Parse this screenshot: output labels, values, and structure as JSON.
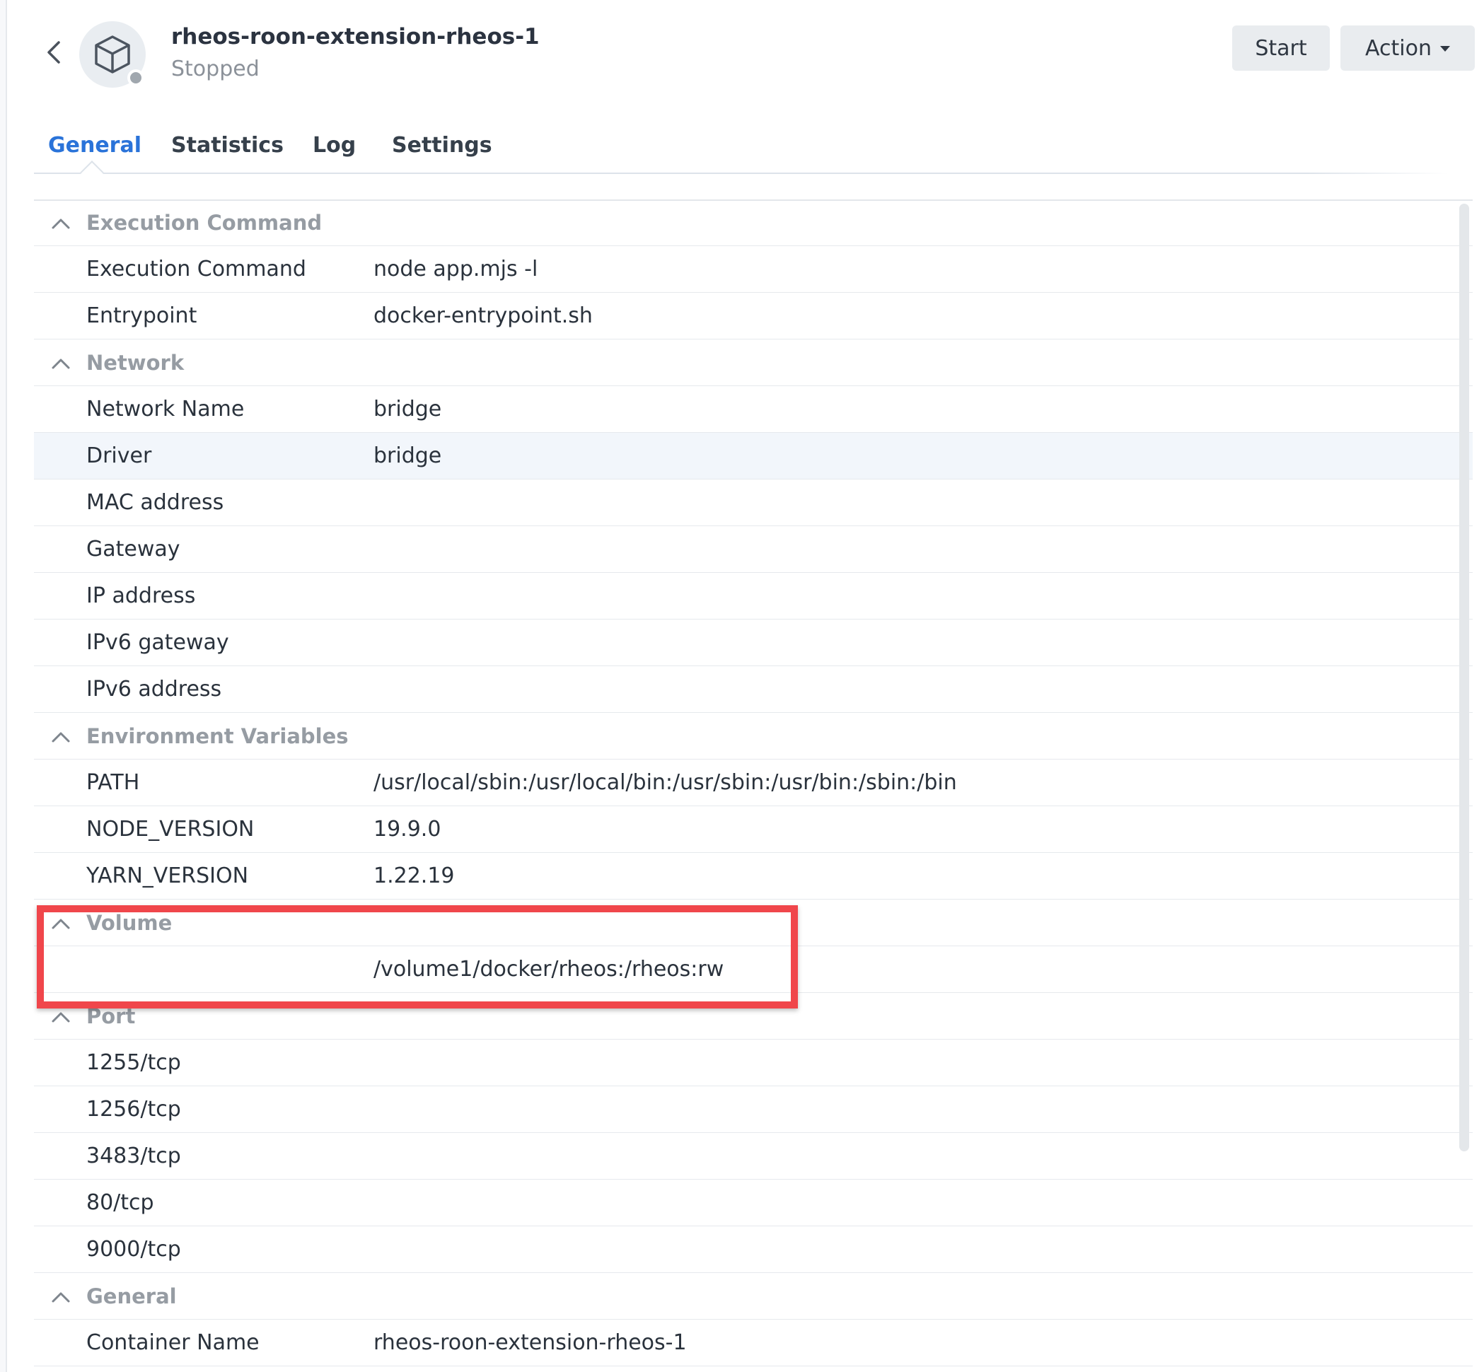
{
  "header": {
    "title": "rheos-roon-extension-rheos-1",
    "status": "Stopped",
    "status_color": "#a0a7ae",
    "icons": {
      "back": "chevron-left-icon",
      "container": "cube-icon"
    },
    "buttons": {
      "start_label": "Start",
      "action_label": "Action"
    }
  },
  "tabs": [
    {
      "label": "General",
      "active": true
    },
    {
      "label": "Statistics",
      "active": false
    },
    {
      "label": "Log",
      "active": false
    },
    {
      "label": "Settings",
      "active": false
    }
  ],
  "colors": {
    "accent": "#2a73d9",
    "annotation": "#f0464b"
  },
  "sections": {
    "execution": {
      "title": "Execution Command",
      "rows": [
        {
          "key": "Execution Command",
          "value": "node app.mjs -l"
        },
        {
          "key": "Entrypoint",
          "value": "docker-entrypoint.sh"
        }
      ]
    },
    "network": {
      "title": "Network",
      "rows": [
        {
          "key": "Network Name",
          "value": "bridge"
        },
        {
          "key": "Driver",
          "value": "bridge"
        },
        {
          "key": "MAC address",
          "value": ""
        },
        {
          "key": "Gateway",
          "value": ""
        },
        {
          "key": "IP address",
          "value": ""
        },
        {
          "key": "IPv6 gateway",
          "value": ""
        },
        {
          "key": "IPv6 address",
          "value": ""
        }
      ]
    },
    "env": {
      "title": "Environment Variables",
      "rows": [
        {
          "key": "PATH",
          "value": "/usr/local/sbin:/usr/local/bin:/usr/sbin:/usr/bin:/sbin:/bin"
        },
        {
          "key": "NODE_VERSION",
          "value": "19.9.0"
        },
        {
          "key": "YARN_VERSION",
          "value": "1.22.19"
        }
      ]
    },
    "volume": {
      "title": "Volume",
      "rows": [
        {
          "key": "",
          "value": "/volume1/docker/rheos:/rheos:rw"
        }
      ]
    },
    "port": {
      "title": "Port",
      "rows": [
        {
          "key": "1255/tcp",
          "value": ""
        },
        {
          "key": "1256/tcp",
          "value": ""
        },
        {
          "key": "3483/tcp",
          "value": ""
        },
        {
          "key": "80/tcp",
          "value": ""
        },
        {
          "key": "9000/tcp",
          "value": ""
        }
      ]
    },
    "general": {
      "title": "General",
      "rows": [
        {
          "key": "Container Name",
          "value": "rheos-roon-extension-rheos-1"
        }
      ]
    }
  }
}
